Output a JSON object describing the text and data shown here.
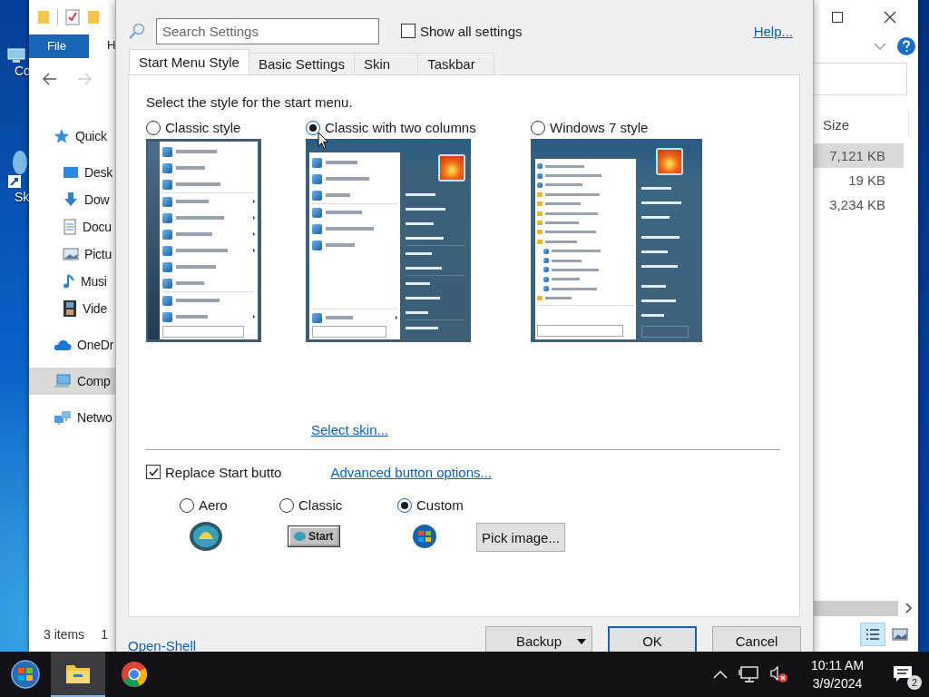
{
  "desktop": {
    "icons": [
      {
        "label": "Co",
        "kind": "computer"
      },
      {
        "label": "Sk",
        "kind": "shortcut"
      }
    ]
  },
  "explorer": {
    "ribbon_tabs": [
      {
        "label": "File",
        "selected": true
      },
      {
        "label": "H",
        "selected": false
      }
    ],
    "nav_items": [
      {
        "label": "Quick",
        "kind": "star",
        "selected": false,
        "children": [
          {
            "label": "Desk",
            "kind": "desktop",
            "selected": false
          },
          {
            "label": "Dow",
            "kind": "download",
            "selected": false
          },
          {
            "label": "Docu",
            "kind": "document",
            "selected": false
          },
          {
            "label": "Pictu",
            "kind": "picture",
            "selected": false
          },
          {
            "label": "Musi",
            "kind": "music",
            "selected": false
          },
          {
            "label": "Vide",
            "kind": "video",
            "selected": false
          }
        ]
      },
      {
        "label": "OneDr",
        "kind": "cloud",
        "selected": false
      },
      {
        "label": "Comp",
        "kind": "computer",
        "selected": true
      },
      {
        "label": "Netwo",
        "kind": "network",
        "selected": false
      }
    ],
    "column_header": "Size",
    "rows": [
      {
        "size": "7,121 KB",
        "selected": true
      },
      {
        "size": "19 KB",
        "selected": false
      },
      {
        "size": "3,234 KB",
        "selected": false
      }
    ],
    "status": "3 items",
    "status_2": "1",
    "views": [
      {
        "kind": "details",
        "selected": true
      },
      {
        "kind": "tiles",
        "selected": false
      }
    ]
  },
  "dialog": {
    "search": {
      "placeholder": "Search Settings"
    },
    "show_all": {
      "label": "Show all settings",
      "checked": false
    },
    "help": "Help...",
    "tabs": [
      {
        "label": "Start Menu Style",
        "selected": true
      },
      {
        "label": "Basic Settings",
        "selected": false
      },
      {
        "label": "Skin",
        "selected": false
      },
      {
        "label": "Taskbar",
        "selected": false
      }
    ],
    "prompt": "Select the style for the start menu.",
    "styles": [
      {
        "label": "Classic style",
        "selected": false,
        "kind": "classic"
      },
      {
        "label": "Classic with two columns",
        "selected": true,
        "kind": "two_columns"
      },
      {
        "label": "Windows 7 style",
        "selected": false,
        "kind": "win7"
      }
    ],
    "skin_link": "Select skin...",
    "replace_start": {
      "label": "Replace Start butto",
      "checked": true
    },
    "advanced_link": "Advanced button options...",
    "button_styles": [
      {
        "label": "Aero",
        "selected": false,
        "kind": "aero"
      },
      {
        "label": "Classic",
        "selected": false,
        "kind": "classic",
        "text": "Start"
      },
      {
        "label": "Custom",
        "selected": true,
        "kind": "custom"
      }
    ],
    "pick_image": "Pick image...",
    "footer_link": "Open-Shell",
    "buttons": [
      {
        "label": "Backup",
        "kind": "dropdown",
        "default": false
      },
      {
        "label": "OK",
        "kind": "plain",
        "default": true
      },
      {
        "label": "Cancel",
        "kind": "plain",
        "default": false
      }
    ]
  },
  "taskbar": {
    "apps": [
      {
        "kind": "explorer",
        "active": true
      },
      {
        "kind": "chrome",
        "active": false
      }
    ],
    "time": "10:11 AM",
    "date": "3/9/2024",
    "notifications": "2"
  }
}
